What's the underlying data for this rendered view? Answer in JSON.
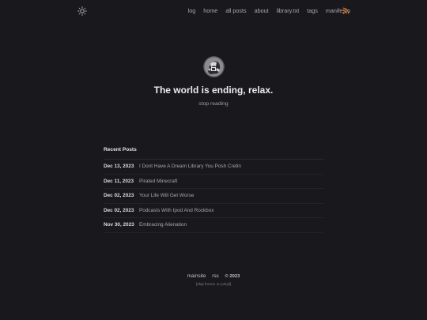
{
  "header": {
    "theme_toggle_icon": "sun-icon",
    "nav": [
      {
        "label": "log"
      },
      {
        "label": "home"
      },
      {
        "label": "all posts"
      },
      {
        "label": "about"
      },
      {
        "label": "library.txt"
      },
      {
        "label": "tags"
      },
      {
        "label": "manifesto"
      }
    ],
    "rss_icon": "rss-icon",
    "rss_color": "#e07a26"
  },
  "hero": {
    "title": "The world is ending, relax.",
    "tagline": "stop reading"
  },
  "recent_posts": {
    "heading": "Recent Posts",
    "posts": [
      {
        "date": "Dec 13, 2023",
        "title": "I Dont Have A Dream Library You Posh Cretin"
      },
      {
        "date": "Dec 11, 2023",
        "title": "Pirated Minecraft"
      },
      {
        "date": "Dec 02, 2023",
        "title": "Your Life Will Get Worse"
      },
      {
        "date": "Dec 02, 2023",
        "title": "Podcasts With Ipod And Rockbox"
      },
      {
        "date": "Nov 30, 2023",
        "title": "Embracing Alienation"
      }
    ]
  },
  "footer": {
    "mainsite": "mainsite",
    "rss": "rss",
    "copyright": "© 2023",
    "credit": "[dlaji theme on jekyll]"
  }
}
